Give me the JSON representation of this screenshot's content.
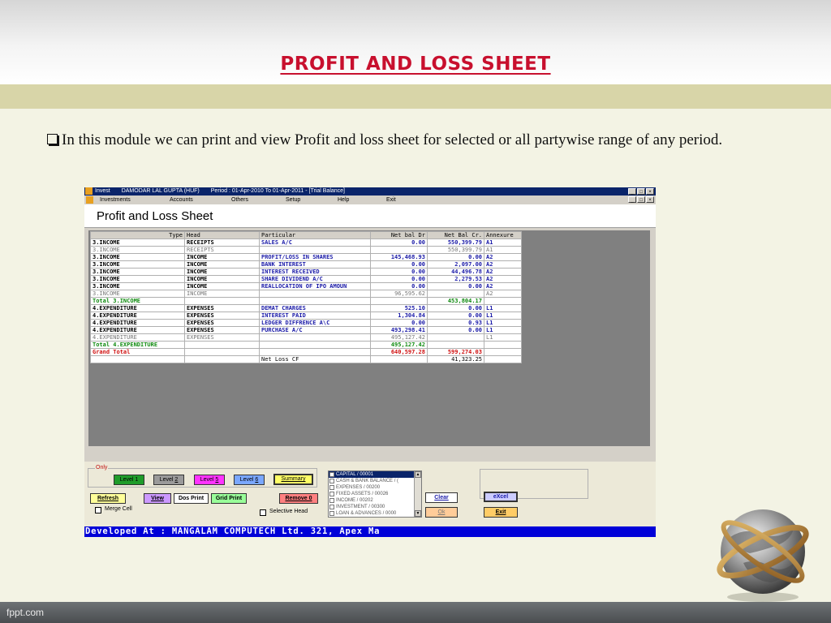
{
  "slide": {
    "title": "PROFIT AND LOSS SHEET",
    "bullet_text": "In this module we can print and view Profit and loss sheet for selected or all partywise range of any period.",
    "footer": "fppt.com"
  },
  "window": {
    "app_name": "Invest",
    "client": "DAMODAR LAL GUPTA (HUF)",
    "period": "Period : 01-Apr-2010 To 01-Apr-2011 - [Trial Balance]",
    "win_buttons": [
      "_",
      "□",
      "×"
    ],
    "menu": [
      "Investments",
      "Accounts",
      "Others",
      "Setup",
      "Help",
      "Exit"
    ]
  },
  "report": {
    "heading": "Profit and Loss Sheet"
  },
  "grid": {
    "columns": [
      "Type",
      "Head",
      "Particular",
      "Net bal Dr",
      "Net Bal Cr.",
      "Annexure"
    ],
    "rows": [
      {
        "type": "3.INCOME",
        "head": "RECEIPTS",
        "particular": "SALES A/C",
        "dr": "0.00",
        "cr": "550,399.79",
        "ann": "A1",
        "style": "blue"
      },
      {
        "type": "3.INCOME",
        "head": "RECEIPTS",
        "particular": "",
        "dr": "",
        "cr": "550,399.79",
        "ann": "A1",
        "style": "gray"
      },
      {
        "type": "3.INCOME",
        "head": "INCOME",
        "particular": "PROFIT/LOSS IN SHARES",
        "dr": "145,468.93",
        "cr": "0.00",
        "ann": "A2",
        "style": "blue"
      },
      {
        "type": "3.INCOME",
        "head": "INCOME",
        "particular": "BANK INTEREST",
        "dr": "0.00",
        "cr": "2,097.00",
        "ann": "A2",
        "style": "blue"
      },
      {
        "type": "3.INCOME",
        "head": "INCOME",
        "particular": "INTEREST RECEIVED",
        "dr": "0.00",
        "cr": "44,496.78",
        "ann": "A2",
        "style": "blue"
      },
      {
        "type": "3.INCOME",
        "head": "INCOME",
        "particular": "SHARE DIVIDEND A/C",
        "dr": "0.00",
        "cr": "2,279.53",
        "ann": "A2",
        "style": "blue"
      },
      {
        "type": "3.INCOME",
        "head": "INCOME",
        "particular": "REALLOCATION OF IPO AMOUN",
        "dr": "0.00",
        "cr": "0.00",
        "ann": "A2",
        "style": "blue"
      },
      {
        "type": "3.INCOME",
        "head": "INCOME",
        "particular": "",
        "dr": "96,595.62",
        "cr": "",
        "ann": "A2",
        "style": "gray"
      },
      {
        "type": "Total 3.INCOME",
        "head": "",
        "particular": "",
        "dr": "",
        "cr": "453,804.17",
        "ann": "",
        "style": "green"
      },
      {
        "type": "4.EXPENDITURE",
        "head": "EXPENSES",
        "particular": "DEMAT CHARGES",
        "dr": "525.10",
        "cr": "0.00",
        "ann": "L1",
        "style": "blue"
      },
      {
        "type": "4.EXPENDITURE",
        "head": "EXPENSES",
        "particular": "INTEREST PAID",
        "dr": "1,304.84",
        "cr": "0.00",
        "ann": "L1",
        "style": "blue"
      },
      {
        "type": "4.EXPENDITURE",
        "head": "EXPENSES",
        "particular": "LEDGER DIFFRENCE A\\C",
        "dr": "0.00",
        "cr": "0.93",
        "ann": "L1",
        "style": "blue"
      },
      {
        "type": "4.EXPENDITURE",
        "head": "EXPENSES",
        "particular": "PURCHASE A/C",
        "dr": "493,298.41",
        "cr": "0.00",
        "ann": "L1",
        "style": "blue"
      },
      {
        "type": "4.EXPENDITURE",
        "head": "EXPENSES",
        "particular": "",
        "dr": "495,127.42",
        "cr": "",
        "ann": "L1",
        "style": "gray"
      },
      {
        "type": "Total 4.EXPENDITURE",
        "head": "",
        "particular": "",
        "dr": "495,127.42",
        "cr": "",
        "ann": "",
        "style": "green"
      },
      {
        "type": "Grand Total",
        "head": "",
        "particular": "",
        "dr": "640,597.28",
        "cr": "599,274.03",
        "ann": "",
        "style": "red"
      },
      {
        "type": "",
        "head": "",
        "particular": "Net Loss CF",
        "dr": "",
        "cr": "41,323.25",
        "ann": "",
        "style": "plain"
      }
    ]
  },
  "controls": {
    "only_label": "Only",
    "levels": [
      {
        "label": "Level 1",
        "underline": "",
        "color": "#1f9c2a",
        "text_color": "#000"
      },
      {
        "label": "Level ",
        "underline": "2",
        "color": "#9a9a9a",
        "text_color": "#000"
      },
      {
        "label": "Level ",
        "underline": "5",
        "color": "#ff33ff",
        "text_color": "#000"
      },
      {
        "label": "Level ",
        "underline": "6",
        "color": "#7aa7ff",
        "text_color": "#000"
      }
    ],
    "summary": "Summary",
    "refresh": "Refresh",
    "view": "View",
    "dos_print": "Dos Print",
    "grid_print": "Grid Print",
    "remove0": "Remove 0",
    "merge_cell": "Merge Cell",
    "selective_head": "Selective Head",
    "accounts_list": [
      "CAPITAL / 00001",
      "CASH & BANK BALANCE / (",
      "EXPENSES / 00200",
      "FIXED ASSETS / 00026",
      "INCOME / 00202",
      "INVESTMENT / 00300",
      "LOAN & ADVANCES / 0000"
    ],
    "clear": "Clear",
    "excel": "eXcel",
    "ok": "Ok",
    "exit": "Exit",
    "status": "Developed At : MANGALAM COMPUTECH Ltd. 321, Apex Ma"
  }
}
